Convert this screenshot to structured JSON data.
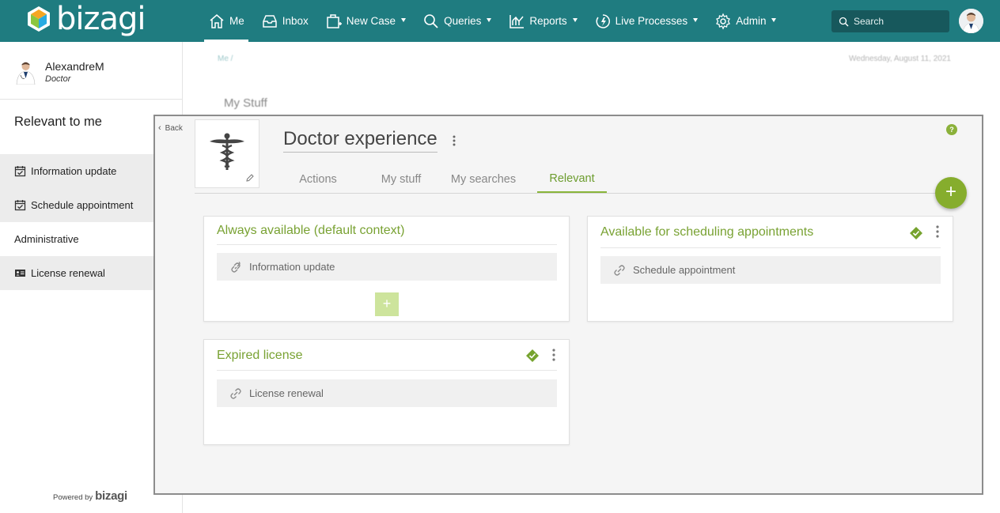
{
  "app": {
    "logo_text": "bizagi"
  },
  "nav": {
    "items": [
      {
        "label": "Me",
        "icon": "home-icon",
        "active": true,
        "dropdown": false
      },
      {
        "label": "Inbox",
        "icon": "inbox-icon",
        "active": false,
        "dropdown": false
      },
      {
        "label": "New Case",
        "icon": "new-case-icon",
        "active": false,
        "dropdown": true
      },
      {
        "label": "Queries",
        "icon": "search-icon",
        "active": false,
        "dropdown": true
      },
      {
        "label": "Reports",
        "icon": "chart-icon",
        "active": false,
        "dropdown": true
      },
      {
        "label": "Live Processes",
        "icon": "lightning-icon",
        "active": false,
        "dropdown": true
      },
      {
        "label": "Admin",
        "icon": "gear-icon",
        "active": false,
        "dropdown": true
      }
    ],
    "search_placeholder": "Search"
  },
  "user": {
    "name": "AlexandreM",
    "role": "Doctor"
  },
  "sidebar": {
    "title": "Relevant to me",
    "items": [
      {
        "label": "Information update",
        "icon": "calendar-check-icon"
      },
      {
        "label": "Schedule appointment",
        "icon": "calendar-check-icon"
      },
      {
        "label": "Administrative",
        "icon": ""
      },
      {
        "label": "License renewal",
        "icon": "id-card-icon"
      }
    ],
    "powered_by": "Powered by",
    "powered_brand": "bizagi"
  },
  "background": {
    "breadcrumb": "Me /",
    "date": "Wednesday, August 11, 2021",
    "title": "My Stuff"
  },
  "panel": {
    "back_label": "Back",
    "title": "Doctor experience",
    "help": "?",
    "tabs": [
      {
        "label": "Actions",
        "active": false
      },
      {
        "label": "My stuff",
        "active": false
      },
      {
        "label": "My searches",
        "active": false
      },
      {
        "label": "Relevant",
        "active": true
      }
    ],
    "fab": "+",
    "cards": [
      {
        "title": "Always available (default context)",
        "links": [
          "Information update"
        ],
        "has_add": true,
        "add_label": "+"
      },
      {
        "title": "Available for scheduling appointments",
        "links": [
          "Schedule appointment"
        ],
        "has_add": false
      },
      {
        "title": "Expired license",
        "links": [
          "License renewal"
        ],
        "has_add": false
      }
    ]
  },
  "colors": {
    "topbar": "#1f7c80",
    "accent_green": "#79a233",
    "fab_green": "#86ad2d"
  }
}
